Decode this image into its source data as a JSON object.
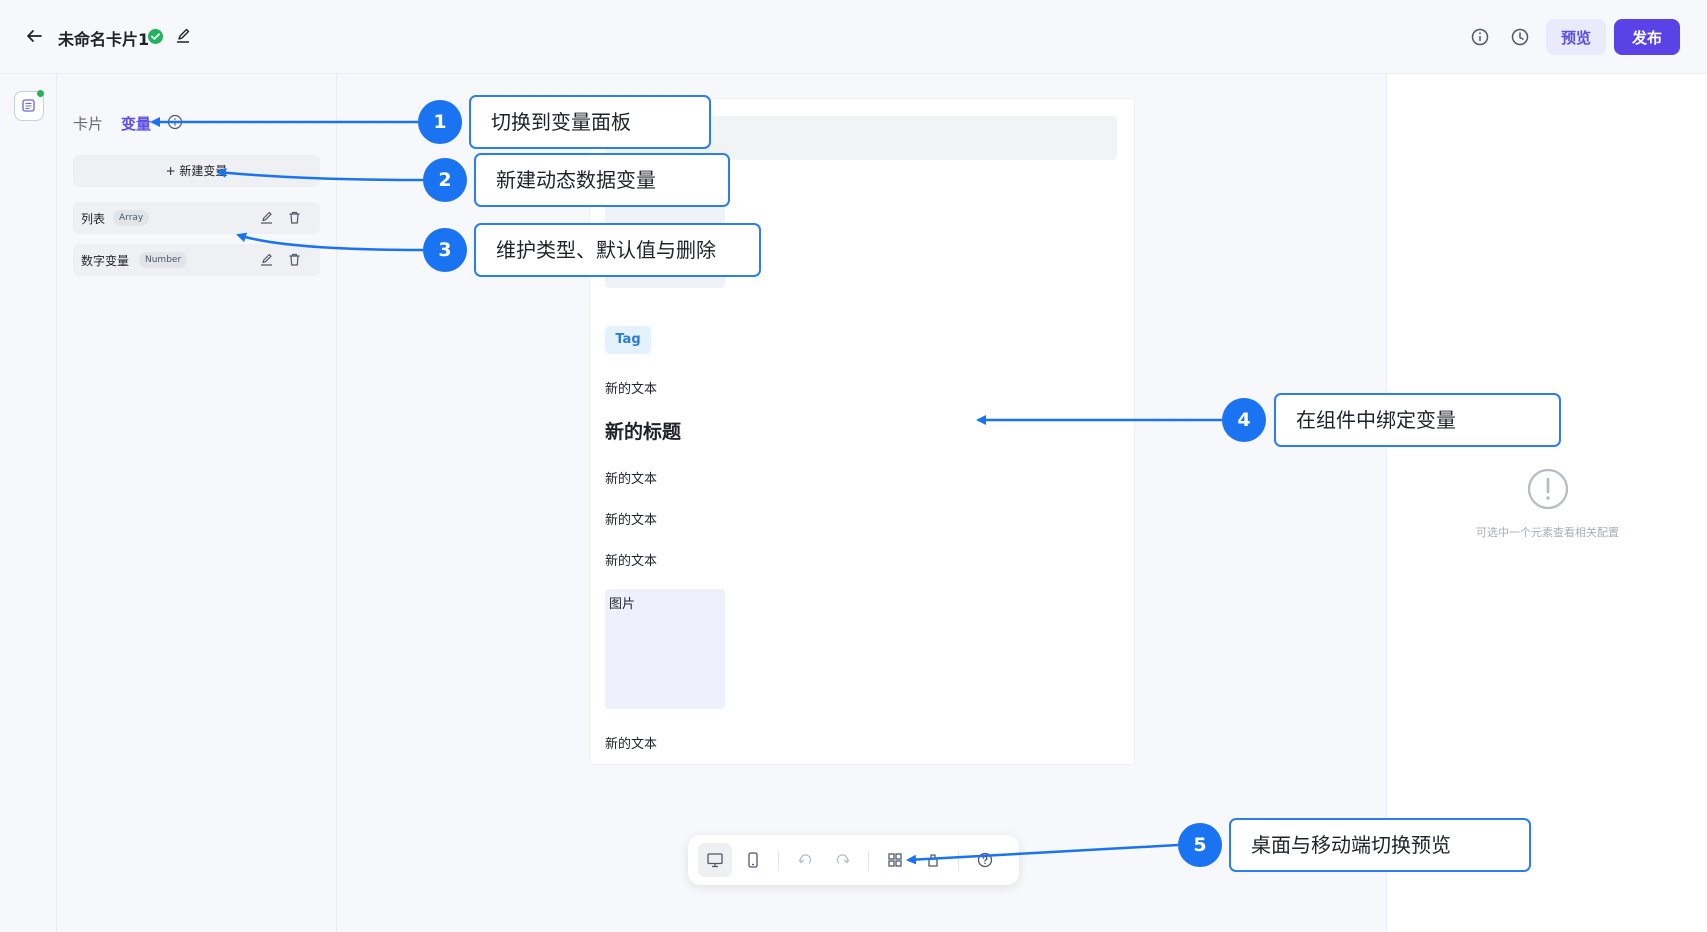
{
  "header": {
    "title": "未命名卡片1",
    "preview_label": "预览",
    "publish_label": "发布",
    "accent_color": "#5b42e6"
  },
  "sidebar": {
    "tabs": [
      {
        "label": "卡片",
        "active": false
      },
      {
        "label": "变量",
        "active": true
      }
    ],
    "new_variable_label": "+ 新建变量",
    "variables": [
      {
        "name": "列表",
        "type": "Array"
      },
      {
        "name": "数字变量",
        "type": "Number"
      }
    ]
  },
  "canvas": {
    "tag_label": "Tag",
    "text_1": "新的文本",
    "heading": "新的标题",
    "text_2": "新的文本",
    "text_3": "新的文本",
    "text_4": "新的文本",
    "image_alt": "图片",
    "text_5": "新的文本"
  },
  "properties": {
    "empty_hint": "可选中一个元素查看相关配置"
  },
  "toolbar": {
    "buttons": [
      "desktop-view",
      "mobile-view",
      "undo",
      "redo",
      "components",
      "clear",
      "help"
    ],
    "active": "desktop-view"
  },
  "annotations": [
    {
      "number": "1",
      "text": "切换到变量面板"
    },
    {
      "number": "2",
      "text": "新建动态数据变量"
    },
    {
      "number": "3",
      "text": "维护类型、默认值与删除"
    },
    {
      "number": "4",
      "text": "在组件中绑定变量"
    },
    {
      "number": "5",
      "text": "桌面与移动端切换预览"
    }
  ]
}
